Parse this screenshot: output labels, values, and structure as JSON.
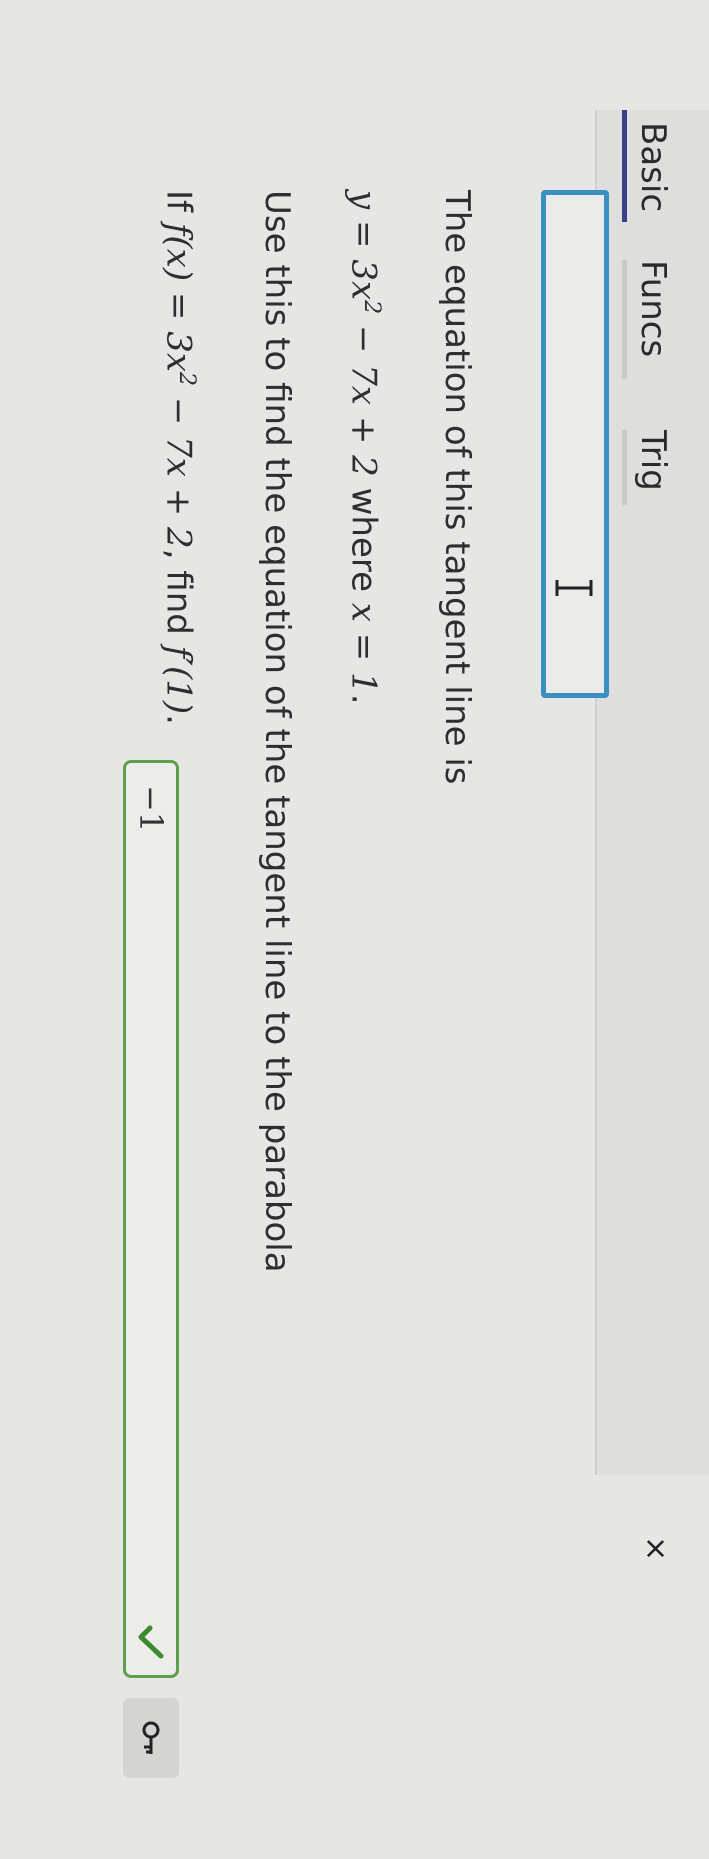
{
  "question1": {
    "prefix": "If ",
    "func": "f(x)",
    "eq1": " = 3x",
    "exp": "2",
    "eq2": " − 7x + 2",
    "mid": ", find ",
    "deriv": "f′(1)",
    "end": "."
  },
  "answer": {
    "value": "−1",
    "status": "correct",
    "status_color": "#3b8a2c"
  },
  "key_button": {
    "icon": "key-icon"
  },
  "paragraph2": "Use this to find the equation of the tangent line to the parabola",
  "equation": {
    "lhs": "y = 3x",
    "exp": "2",
    "rhs": " − 7x + 2",
    "where": " where ",
    "cond": "x = 1",
    "end": "."
  },
  "paragraph3": "The equation of this tangent line is",
  "input": {
    "value": "",
    "cursor_icon": "ibeam-icon",
    "border_color": "#3a8fc1"
  },
  "keyboard": {
    "tabs": [
      {
        "label": "Basic",
        "active": true
      },
      {
        "label": "Funcs",
        "active": false
      },
      {
        "label": "Trig",
        "active": false
      }
    ],
    "close_icon": "×",
    "active_color": "#3a3f87"
  }
}
